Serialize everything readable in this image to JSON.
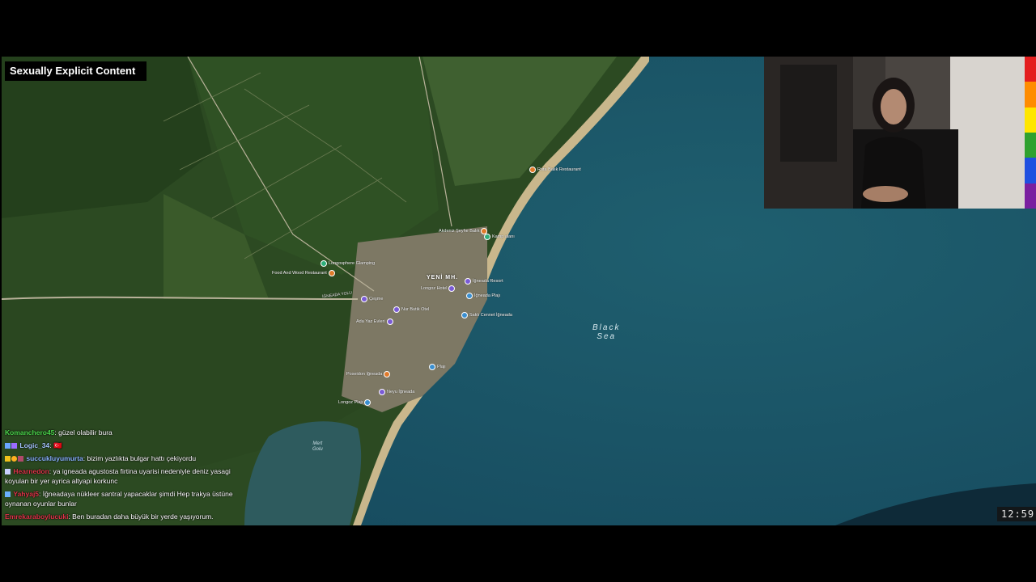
{
  "overlay": {
    "content_warning": "Sexually Explicit Content",
    "clock": "12:59",
    "rainbow_colors": [
      "#e41e1e",
      "#ff8c00",
      "#ffe600",
      "#2fa12f",
      "#1f4fe0",
      "#7a1fa0"
    ]
  },
  "map": {
    "sea_label": [
      "Black",
      "Sea"
    ],
    "lake_label": [
      "Mert",
      "Golu"
    ],
    "town_label": "YENİ MH.",
    "road_label": "İĞNEADA YOLU",
    "pois": [
      {
        "label": "Rota Balık Restaurant",
        "kind": "orange"
      },
      {
        "label": "Kamp alanı",
        "kind": "green"
      },
      {
        "label": "Akdeniz Şeyhe Balık",
        "kind": "orange"
      },
      {
        "label": "Longosphere Glamping",
        "kind": "green"
      },
      {
        "label": "Food And Wood Restaurant",
        "kind": "orange"
      },
      {
        "label": "İğneada Resort",
        "kind": "purple"
      },
      {
        "label": "Longoz Hotel",
        "kind": "purple"
      },
      {
        "label": "İğneada Plajı",
        "kind": "blue"
      },
      {
        "label": "Çeşme",
        "kind": "purple"
      },
      {
        "label": "Nur Butik Otel",
        "kind": "purple"
      },
      {
        "label": "Saklı Cennet İğneada",
        "kind": "blue"
      },
      {
        "label": "Ada Yaz Evleri",
        "kind": "purple"
      },
      {
        "label": "Plajı",
        "kind": "blue"
      },
      {
        "label": "Poseidon İğneada",
        "kind": "orange"
      },
      {
        "label": "Neyu İğneada",
        "kind": "purple"
      },
      {
        "label": "Longoz Plajı",
        "kind": "blue"
      }
    ]
  },
  "chat": [
    {
      "user": "Komanchero45",
      "user_color": "#4cd94c",
      "text": ": güzel olabilir bura"
    },
    {
      "user": "Logic_34",
      "user_color": "#a7c7ff",
      "text": ": 🇹🇷"
    },
    {
      "user": "succukluyumurta",
      "user_color": "#8ab4ff",
      "text": ": bizim yazlıkta bulgar hattı çekiyordu"
    },
    {
      "user": "Hearnedon",
      "user_color": "#e0354a",
      "text": ": ya igneada agustosta firtina uyarisi nedeniyle deniz yasagi koyulan bir yer ayrica altyapi korkunc"
    },
    {
      "user": "Yahyaj5",
      "user_color": "#e0354a",
      "text": ": İğneadaya nükleer santral yapacaklar şimdi Hep trakya üstüne oynanan oyunlar bunlar"
    },
    {
      "user": "Emrekaraboylucuki",
      "user_color": "#e0354a",
      "text": ": Ben buradan daha büyük bir yerde yaşıyorum."
    }
  ]
}
